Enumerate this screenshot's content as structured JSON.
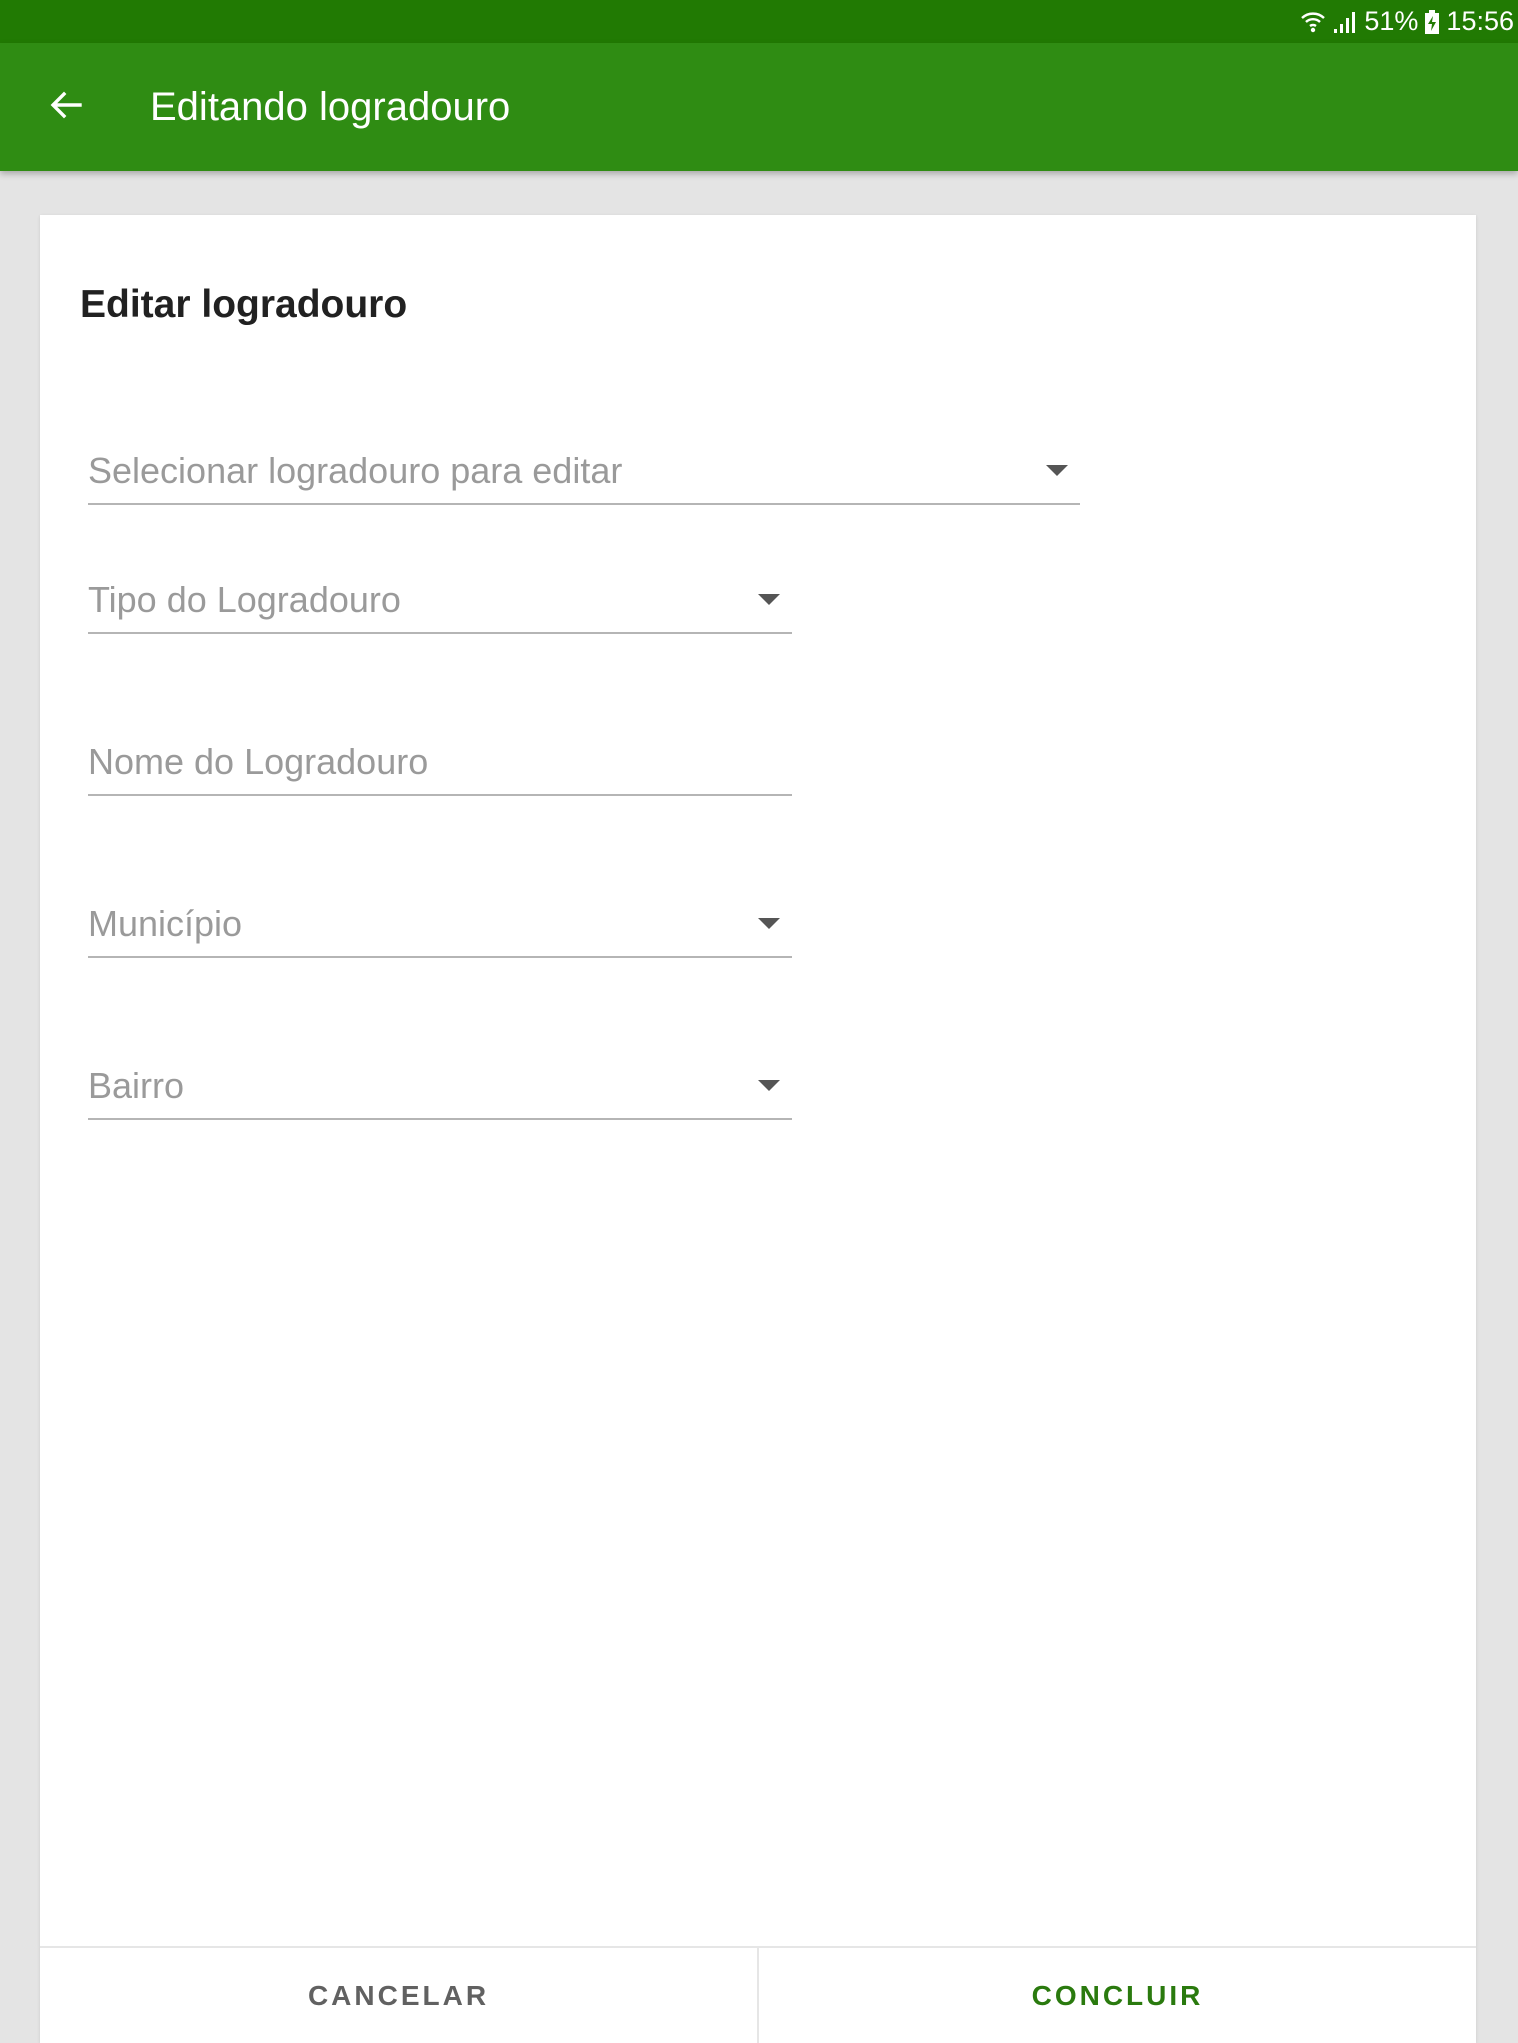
{
  "status_bar": {
    "battery": "51%",
    "time": "15:56",
    "icons": [
      "wifi-icon",
      "signal-icon",
      "battery-charging-icon"
    ]
  },
  "app_bar": {
    "back_icon": "arrow-back-icon",
    "title": "Editando logradouro"
  },
  "card": {
    "title": "Editar logradouro",
    "fields": {
      "select_logradouro": {
        "placeholder": "Selecionar logradouro para editar",
        "type": "dropdown"
      },
      "tipo": {
        "placeholder": "Tipo do Logradouro",
        "type": "dropdown"
      },
      "nome": {
        "placeholder": "Nome do Logradouro",
        "type": "text",
        "value": ""
      },
      "municipio": {
        "placeholder": "Município",
        "type": "dropdown"
      },
      "bairro": {
        "placeholder": "Bairro",
        "type": "dropdown"
      }
    },
    "actions": {
      "cancel": "CANCELAR",
      "done": "CONCLUIR"
    }
  },
  "colors": {
    "status_bar": "#217a03",
    "app_bar": "#2f8c13",
    "accent": "#2a7a0e",
    "background": "#e4e4e4"
  }
}
